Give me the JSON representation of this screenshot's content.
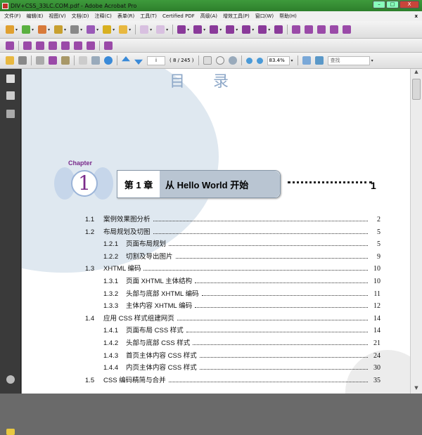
{
  "window": {
    "title": "DIV+CSS_33LC.COM.pdf - Adobe Acrobat Pro",
    "minimize": "–",
    "maximize": "□",
    "close": "X"
  },
  "menu": [
    "文件(F)",
    "编辑(E)",
    "视图(V)",
    "文档(D)",
    "注释(C)",
    "表单(R)",
    "工具(T)",
    "Certified PDF",
    "高级(A)",
    "增效工具(P)",
    "窗口(W)",
    "帮助(H)"
  ],
  "menu_close": "x",
  "toolbar": {
    "page_input": "i",
    "page_count": "( 8 / 245 )",
    "zoom": "83.4%",
    "search_placeholder": "查找"
  },
  "document": {
    "page_title": "目录",
    "chapter_label": "Chapter",
    "chapter_number": "1",
    "chapter_num_text": "第 1 章",
    "chapter_title": "从 Hello World 开始",
    "chapter_page": "1",
    "toc": [
      {
        "num": "1.1",
        "label": "案例效果图分析",
        "page": "2",
        "level": 1
      },
      {
        "num": "1.2",
        "label": "布局规划及切图",
        "page": "5",
        "level": 1
      },
      {
        "num": "1.2.1",
        "label": "页面布局规划",
        "page": "5",
        "level": 2
      },
      {
        "num": "1.2.2",
        "label": "切割及导出图片",
        "page": "9",
        "level": 2
      },
      {
        "num": "1.3",
        "label": "XHTML 编码",
        "page": "10",
        "level": 1
      },
      {
        "num": "1.3.1",
        "label": "页面 XHTML 主体结构",
        "page": "10",
        "level": 2
      },
      {
        "num": "1.3.2",
        "label": "头部与底部 XHTML 编码",
        "page": "11",
        "level": 2
      },
      {
        "num": "1.3.3",
        "label": "主体内容 XHTML 编码",
        "page": "12",
        "level": 2
      },
      {
        "num": "1.4",
        "label": "应用 CSS 样式组建网页",
        "page": "14",
        "level": 1
      },
      {
        "num": "1.4.1",
        "label": "页面布局 CSS 样式",
        "page": "14",
        "level": 2
      },
      {
        "num": "1.4.2",
        "label": "头部与底部 CSS 样式",
        "page": "21",
        "level": 2
      },
      {
        "num": "1.4.3",
        "label": "首页主体内容 CSS 样式",
        "page": "24",
        "level": 2
      },
      {
        "num": "1.4.4",
        "label": "内页主体内容 CSS 样式",
        "page": "30",
        "level": 2
      },
      {
        "num": "1.5",
        "label": "CSS 编码精简与合并",
        "page": "35",
        "level": 1
      }
    ]
  }
}
